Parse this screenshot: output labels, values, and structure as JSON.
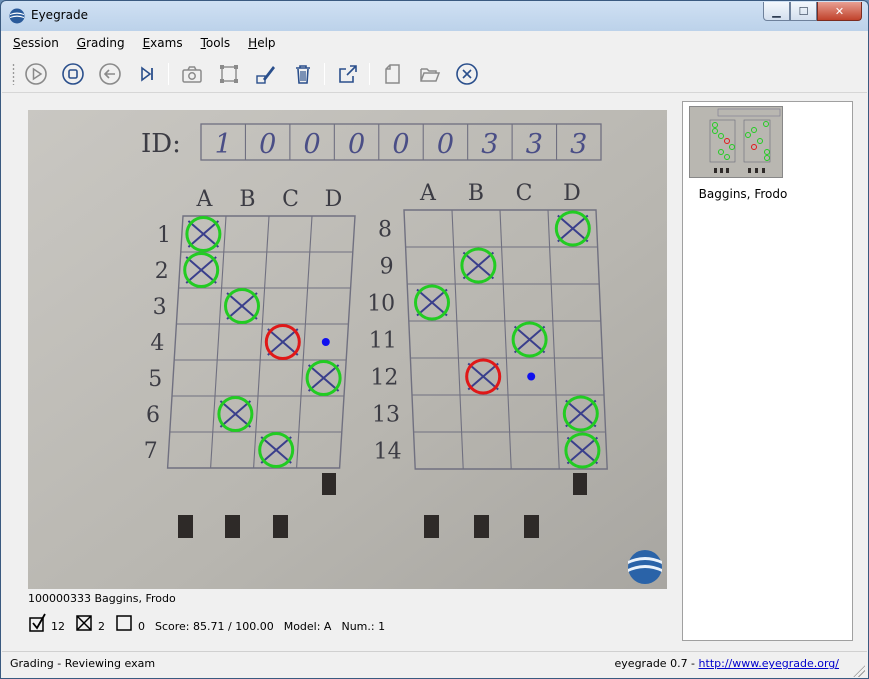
{
  "window": {
    "title": "Eyegrade"
  },
  "menu": [
    {
      "label": "Session",
      "key": "S",
      "rest": "ession"
    },
    {
      "label": "Grading",
      "key": "G",
      "rest": "rading"
    },
    {
      "label": "Exams",
      "key": "E",
      "rest": "xams"
    },
    {
      "label": "Tools",
      "key": "T",
      "rest": "ools"
    },
    {
      "label": "Help",
      "key": "H",
      "rest": "elp"
    }
  ],
  "toolbar": {
    "icons": [
      "play-icon",
      "stop-icon",
      "back-icon",
      "skip-next-icon",
      "camera-icon",
      "crop-icon",
      "edit-pen-icon",
      "trash-icon",
      "export-icon",
      "new-document-icon",
      "open-folder-icon",
      "close-session-icon"
    ]
  },
  "exam_image": {
    "id_label": "ID:",
    "id_digits": [
      "1",
      "0",
      "0",
      "0",
      "0",
      "0",
      "3",
      "3",
      "3"
    ],
    "column_letters": [
      "A",
      "B",
      "C",
      "D"
    ],
    "left_rows": [
      "1",
      "2",
      "3",
      "4",
      "5",
      "6",
      "7"
    ],
    "right_rows": [
      "8",
      "9",
      "10",
      "11",
      "12",
      "13",
      "14"
    ],
    "answers_left": [
      {
        "q": "1",
        "marked": "A",
        "status": "correct"
      },
      {
        "q": "2",
        "marked": "A",
        "status": "correct"
      },
      {
        "q": "3",
        "marked": "B",
        "status": "correct"
      },
      {
        "q": "4",
        "marked": "C",
        "status": "incorrect",
        "correct": "D"
      },
      {
        "q": "5",
        "marked": "D",
        "status": "correct"
      },
      {
        "q": "6",
        "marked": "B",
        "status": "correct"
      },
      {
        "q": "7",
        "marked": "C",
        "status": "correct"
      }
    ],
    "answers_right": [
      {
        "q": "8",
        "marked": "D",
        "status": "correct"
      },
      {
        "q": "9",
        "marked": "B",
        "status": "correct"
      },
      {
        "q": "10",
        "marked": "A",
        "status": "correct"
      },
      {
        "q": "11",
        "marked": "C",
        "status": "correct"
      },
      {
        "q": "12",
        "marked": "B",
        "status": "incorrect",
        "correct": "C"
      },
      {
        "q": "13",
        "marked": "D",
        "status": "correct"
      },
      {
        "q": "14",
        "marked": "D",
        "status": "correct"
      }
    ],
    "colors": {
      "correct": "#22cc22",
      "incorrect": "#e01818",
      "expected": "#1010ee",
      "ink": "#3a3f8c",
      "paper": "#bdbbb5"
    }
  },
  "student": {
    "label": "100000333 Baggins, Frodo"
  },
  "stats": {
    "correct_count": "12",
    "incorrect_count": "2",
    "blank_count": "0",
    "score": "Score: 85.71 / 100.00",
    "model": "Model: A",
    "num": "Num.: 1"
  },
  "side_panel": {
    "thumbnail_name": "Baggins, Frodo"
  },
  "status": {
    "left": "Grading - Reviewing exam",
    "right_prefix": "eyegrade 0.7 - ",
    "link": "http://www.eyegrade.org/"
  }
}
